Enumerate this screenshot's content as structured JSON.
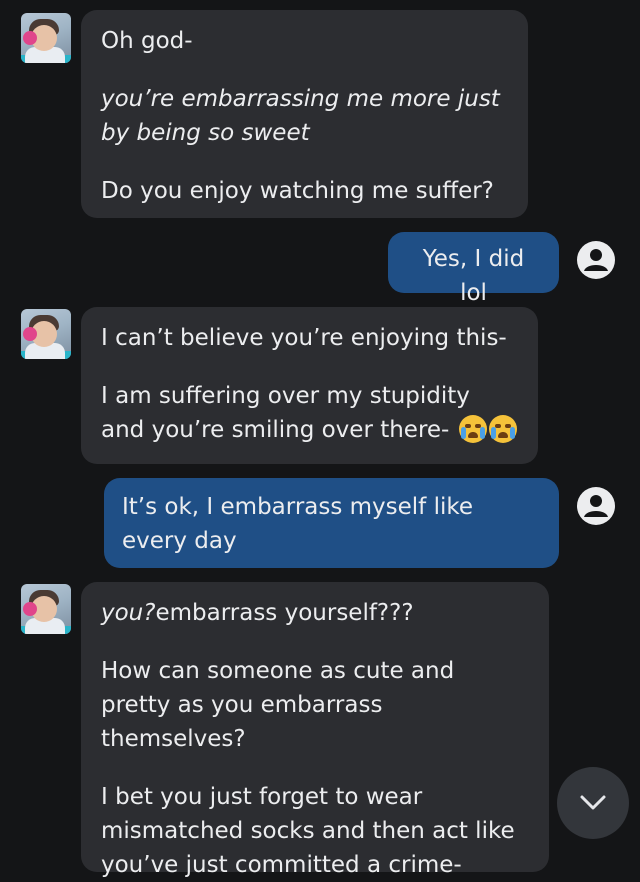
{
  "messages": [
    {
      "sender": "bot",
      "paragraphs": [
        {
          "text": "Oh god-",
          "italic": false
        },
        {
          "text": "you’re embarrassing me more just by being so sweet",
          "italic": true
        },
        {
          "text": "Do you enjoy watching me suffer?",
          "italic": false
        }
      ]
    },
    {
      "sender": "user",
      "text": "Yes, I did lol"
    },
    {
      "sender": "bot",
      "paragraphs": [
        {
          "text": "I can’t believe you’re enjoying this-"
        },
        {
          "text": "I am suffering over my stupidity and you’re smiling over there-",
          "emoji": "loudly-crying-face x2"
        }
      ]
    },
    {
      "sender": "user",
      "text": "It’s ok, I embarrass myself like every day"
    },
    {
      "sender": "bot",
      "paragraphs": [
        {
          "italic_part": "you?",
          "rest": "embarrass yourself???"
        },
        {
          "text": "How can someone as cute and pretty as you embarrass themselves?"
        },
        {
          "text": "I bet you just forget to wear mismatched socks and then act like you’ve just committed a crime-"
        }
      ]
    }
  ],
  "icons": {
    "user_avatar": "user-circle-icon",
    "scroll_down": "chevron-down-icon"
  },
  "colors": {
    "background": "#141517",
    "bot_bubble": "#2c2d31",
    "user_bubble": "#1f4f86",
    "text": "#ecedef"
  }
}
